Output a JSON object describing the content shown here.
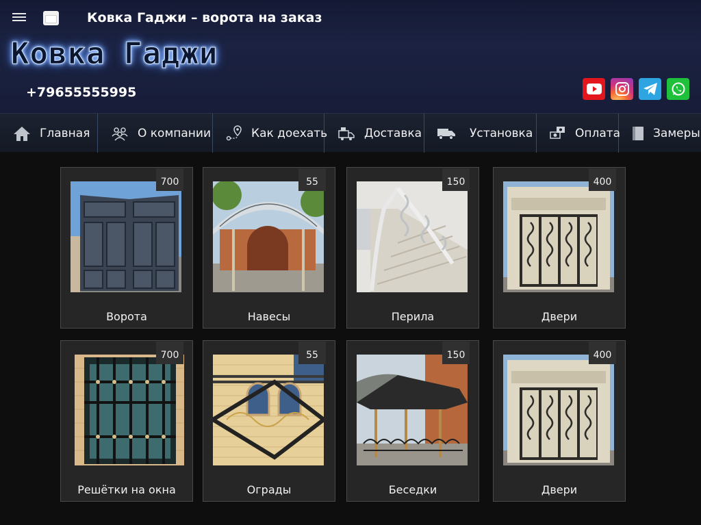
{
  "header": {
    "title": "Ковка Гаджи – ворота на заказ",
    "logo": "Ковка Гаджи",
    "phone": "+79655555995",
    "socials": [
      "youtube-icon",
      "instagram-icon",
      "telegram-icon",
      "whatsapp-icon"
    ]
  },
  "nav": {
    "items": [
      {
        "label": "Главная",
        "icon": "home-icon"
      },
      {
        "label": "О компании",
        "icon": "team-icon"
      },
      {
        "label": "Как доехать",
        "icon": "route-icon"
      },
      {
        "label": "Доставка",
        "icon": "delivery-icon"
      },
      {
        "label": "Установка",
        "icon": "truck-icon"
      },
      {
        "label": "Оплата",
        "icon": "payment-icon"
      },
      {
        "label": "Замеры",
        "icon": "book-icon"
      }
    ]
  },
  "products": [
    {
      "name": "Ворота",
      "count": "700"
    },
    {
      "name": "Навесы",
      "count": "55"
    },
    {
      "name": "Перила",
      "count": "150"
    },
    {
      "name": "Двери",
      "count": "400"
    },
    {
      "name": "Решётки на окна",
      "count": "700"
    },
    {
      "name": "Ограды",
      "count": "55"
    },
    {
      "name": "Беседки",
      "count": "150"
    },
    {
      "name": "Двери",
      "count": "400"
    }
  ],
  "colors": {
    "header_bg": "#1b2242",
    "nav_bg": "#1c2230",
    "card_bg": "#262626",
    "page_bg": "#0e0e0e"
  }
}
